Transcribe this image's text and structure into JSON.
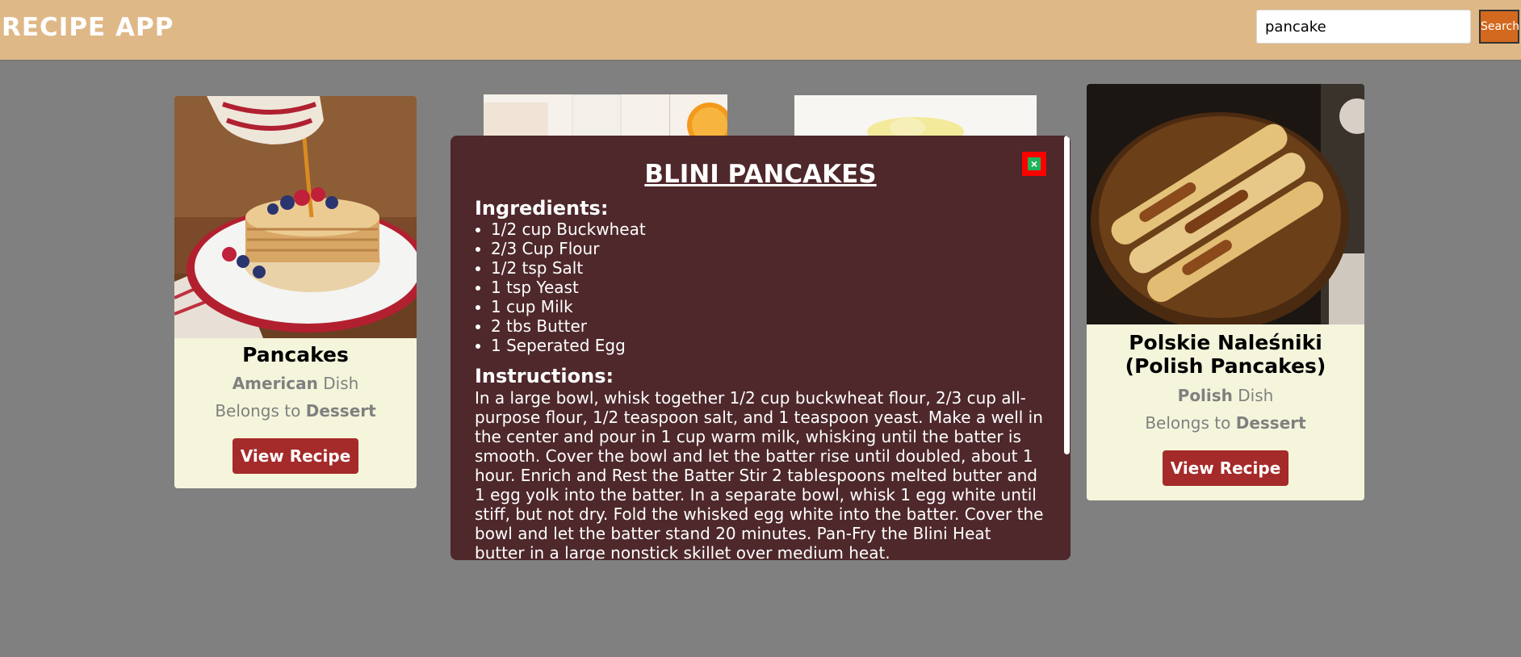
{
  "app": {
    "title": "RECIPE APP"
  },
  "search": {
    "value": "pancake",
    "button_label": "Search"
  },
  "cards": [
    {
      "title": "Pancakes",
      "cuisine": "American",
      "dish_suffix": " Dish",
      "belongs_prefix": "Belongs to ",
      "category": "Dessert",
      "button_label": "View Recipe"
    },
    {
      "title": "Polskie Naleśniki (Polish Pancakes)",
      "cuisine": "Polish",
      "dish_suffix": " Dish",
      "belongs_prefix": "Belongs to ",
      "category": "Dessert",
      "button_label": "View Recipe"
    }
  ],
  "modal": {
    "title": "BLINI PANCAKES",
    "close_icon": "close-icon",
    "ingredients_heading": "Ingredients:",
    "ingredients": [
      "1/2 cup Buckwheat",
      "2/3 Cup Flour",
      "1/2 tsp Salt",
      "1 tsp Yeast",
      "1 cup Milk",
      "2 tbs Butter",
      "1 Seperated Egg"
    ],
    "instructions_heading": "Instructions:",
    "instructions": "In a large bowl, whisk together 1/2 cup buckwheat flour, 2/3 cup all-purpose flour, 1/2 teaspoon salt, and 1 teaspoon yeast. Make a well in the center and pour in 1 cup warm milk, whisking until the batter is smooth. Cover the bowl and let the batter rise until doubled, about 1 hour. Enrich and Rest the Batter Stir 2 tablespoons melted butter and 1 egg yolk into the batter. In a separate bowl, whisk 1 egg white until stiff, but not dry. Fold the whisked egg white into the batter. Cover the bowl and let the batter stand 20 minutes. Pan-Fry the Blini Heat butter in a large nonstick skillet over medium heat."
  },
  "colors": {
    "header": "#deb887",
    "background": "#808080",
    "card": "#f5f5dc",
    "button": "#a52a2a",
    "modal": "#4e282b",
    "search_button": "#d2691e",
    "close": "#ff0000"
  }
}
